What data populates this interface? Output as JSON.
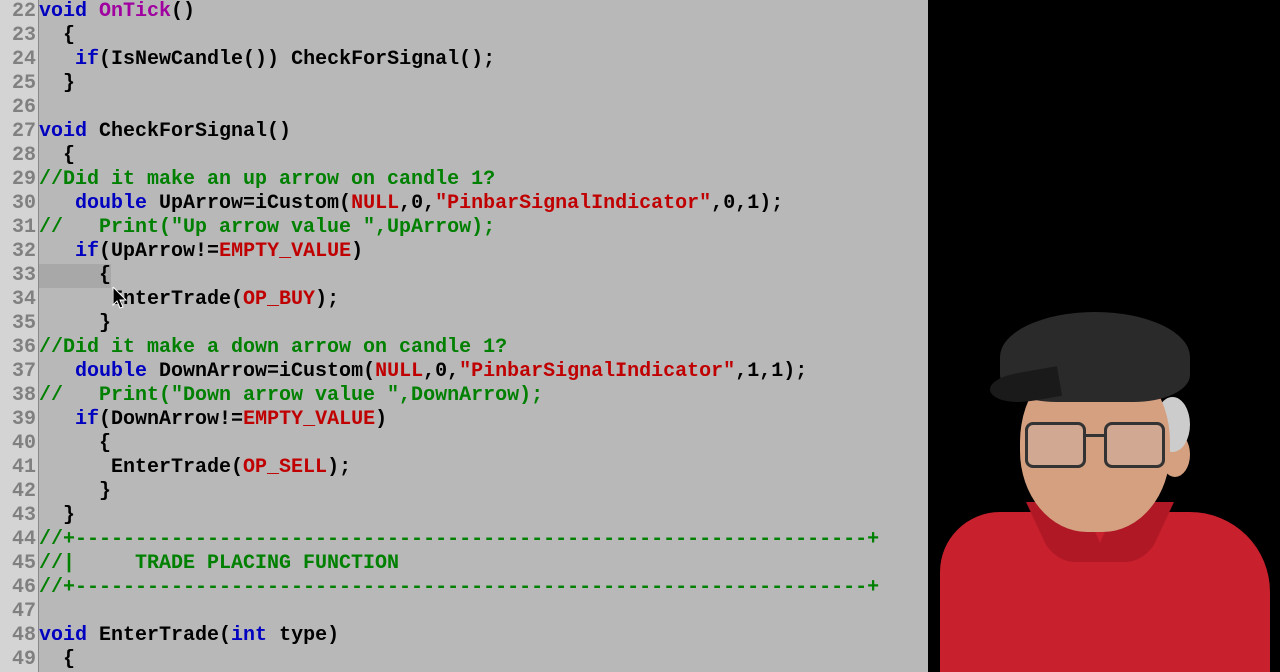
{
  "lines": [
    {
      "num": "22",
      "tokens": [
        {
          "t": "void ",
          "c": "kw"
        },
        {
          "t": "OnTick",
          "c": "id",
          "col": "#a000a0"
        },
        {
          "t": "()",
          "c": "op"
        }
      ]
    },
    {
      "num": "23",
      "tokens": [
        {
          "t": "  {",
          "c": "op"
        }
      ]
    },
    {
      "num": "24",
      "tokens": [
        {
          "t": "   ",
          "c": ""
        },
        {
          "t": "if",
          "c": "kw"
        },
        {
          "t": "(IsNewCandle()) CheckForSignal();",
          "c": "op"
        }
      ]
    },
    {
      "num": "25",
      "tokens": [
        {
          "t": "  }",
          "c": "op"
        }
      ]
    },
    {
      "num": "26",
      "tokens": []
    },
    {
      "num": "27",
      "tokens": [
        {
          "t": "void ",
          "c": "kw"
        },
        {
          "t": "CheckForSignal()",
          "c": "op"
        }
      ]
    },
    {
      "num": "28",
      "tokens": [
        {
          "t": "  {",
          "c": "op"
        }
      ]
    },
    {
      "num": "29",
      "tokens": [
        {
          "t": "//Did it make an up arrow on candle 1?",
          "c": "cm"
        }
      ]
    },
    {
      "num": "30",
      "tokens": [
        {
          "t": "   ",
          "c": ""
        },
        {
          "t": "double ",
          "c": "kw"
        },
        {
          "t": "UpArrow=iCustom(",
          "c": "op"
        },
        {
          "t": "NULL",
          "c": "null"
        },
        {
          "t": ",",
          "c": "op"
        },
        {
          "t": "0",
          "c": "op"
        },
        {
          "t": ",",
          "c": "op"
        },
        {
          "t": "\"PinbarSignalIndicator\"",
          "c": "str"
        },
        {
          "t": ",",
          "c": "op"
        },
        {
          "t": "0",
          "c": "op"
        },
        {
          "t": ",",
          "c": "op"
        },
        {
          "t": "1",
          "c": "op"
        },
        {
          "t": ");",
          "c": "op"
        }
      ]
    },
    {
      "num": "31",
      "tokens": [
        {
          "t": "//   Print(\"Up arrow value \",UpArrow);",
          "c": "cm"
        }
      ]
    },
    {
      "num": "32",
      "tokens": [
        {
          "t": "   ",
          "c": ""
        },
        {
          "t": "if",
          "c": "kw"
        },
        {
          "t": "(UpArrow!=",
          "c": "op"
        },
        {
          "t": "EMPTY_VALUE",
          "c": "const"
        },
        {
          "t": ")",
          "c": "op"
        }
      ]
    },
    {
      "num": "33",
      "tokens": [
        {
          "t": "     {",
          "c": "op"
        }
      ],
      "hl": true
    },
    {
      "num": "34",
      "tokens": [
        {
          "t": "      EnterTrade(",
          "c": "op"
        },
        {
          "t": "OP_BUY",
          "c": "const"
        },
        {
          "t": ");",
          "c": "op"
        }
      ]
    },
    {
      "num": "35",
      "tokens": [
        {
          "t": "     }",
          "c": "op"
        }
      ]
    },
    {
      "num": "36",
      "tokens": [
        {
          "t": "//Did it make a down arrow on candle 1?",
          "c": "cm"
        }
      ]
    },
    {
      "num": "37",
      "tokens": [
        {
          "t": "   ",
          "c": ""
        },
        {
          "t": "double ",
          "c": "kw"
        },
        {
          "t": "DownArrow=iCustom(",
          "c": "op"
        },
        {
          "t": "NULL",
          "c": "null"
        },
        {
          "t": ",",
          "c": "op"
        },
        {
          "t": "0",
          "c": "op"
        },
        {
          "t": ",",
          "c": "op"
        },
        {
          "t": "\"PinbarSignalIndicator\"",
          "c": "str"
        },
        {
          "t": ",",
          "c": "op"
        },
        {
          "t": "1",
          "c": "op"
        },
        {
          "t": ",",
          "c": "op"
        },
        {
          "t": "1",
          "c": "op"
        },
        {
          "t": ");",
          "c": "op"
        }
      ]
    },
    {
      "num": "38",
      "tokens": [
        {
          "t": "//   Print(\"Down arrow value \",DownArrow);",
          "c": "cm"
        }
      ]
    },
    {
      "num": "39",
      "tokens": [
        {
          "t": "   ",
          "c": ""
        },
        {
          "t": "if",
          "c": "kw"
        },
        {
          "t": "(DownArrow!=",
          "c": "op"
        },
        {
          "t": "EMPTY_VALUE",
          "c": "const"
        },
        {
          "t": ")",
          "c": "op"
        }
      ]
    },
    {
      "num": "40",
      "tokens": [
        {
          "t": "     {",
          "c": "op"
        }
      ]
    },
    {
      "num": "41",
      "tokens": [
        {
          "t": "      EnterTrade(",
          "c": "op"
        },
        {
          "t": "OP_SELL",
          "c": "const"
        },
        {
          "t": ");",
          "c": "op"
        }
      ]
    },
    {
      "num": "42",
      "tokens": [
        {
          "t": "     }",
          "c": "op"
        }
      ]
    },
    {
      "num": "43",
      "tokens": [
        {
          "t": "  }",
          "c": "op"
        }
      ]
    },
    {
      "num": "44",
      "tokens": [
        {
          "t": "//+------------------------------------------------------------------+",
          "c": "cm"
        }
      ]
    },
    {
      "num": "45",
      "tokens": [
        {
          "t": "//|     TRADE PLACING FUNCTION",
          "c": "cm"
        }
      ]
    },
    {
      "num": "46",
      "tokens": [
        {
          "t": "//+------------------------------------------------------------------+",
          "c": "cm"
        }
      ]
    },
    {
      "num": "47",
      "tokens": []
    },
    {
      "num": "48",
      "tokens": [
        {
          "t": "void ",
          "c": "kw"
        },
        {
          "t": "EnterTrade(",
          "c": "op"
        },
        {
          "t": "int ",
          "c": "kw"
        },
        {
          "t": "type)",
          "c": "op"
        }
      ]
    },
    {
      "num": "49",
      "tokens": [
        {
          "t": "  {",
          "c": "op"
        }
      ]
    }
  ]
}
